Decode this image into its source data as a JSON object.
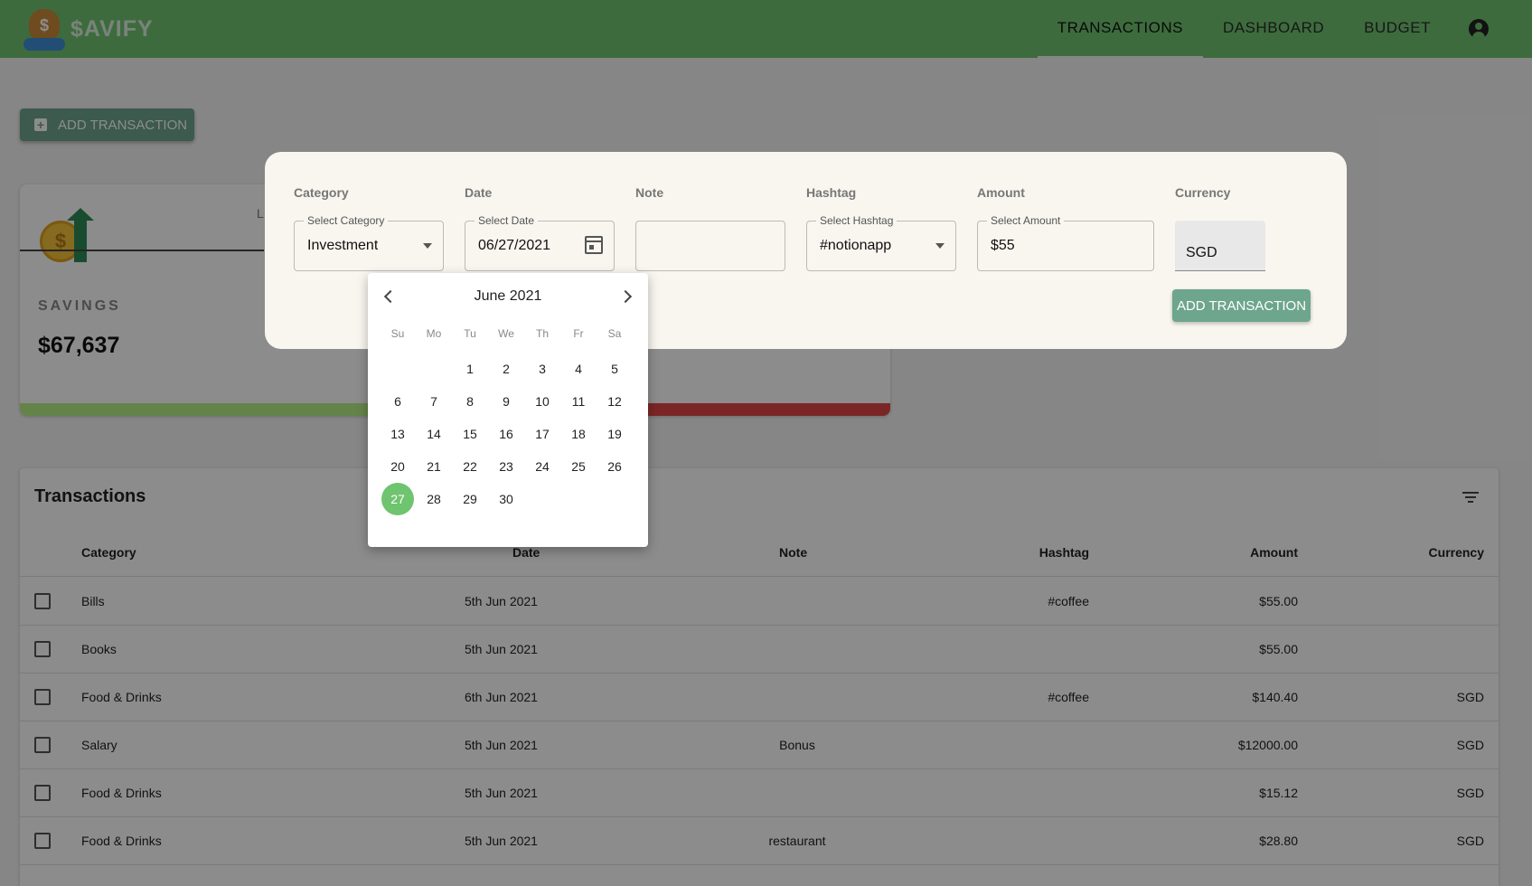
{
  "app": {
    "name": "$AVIFY"
  },
  "nav": {
    "tabs": [
      "TRANSACTIONS",
      "DASHBOARD",
      "BUDGET"
    ],
    "active": "TRANSACTIONS"
  },
  "page": {
    "add_transaction_label": "ADD TRANSACTION"
  },
  "savings": {
    "partial_label": "L",
    "label": "SAVINGS",
    "value": "$67,637"
  },
  "transactions": {
    "title": "Transactions",
    "columns": [
      "Category",
      "Date",
      "Note",
      "Hashtag",
      "Amount",
      "Currency"
    ],
    "rows": [
      {
        "category": "Bills",
        "date": "5th Jun 2021",
        "note": "",
        "hashtag": "#coffee",
        "amount": "$55.00",
        "currency": ""
      },
      {
        "category": "Books",
        "date": "5th Jun 2021",
        "note": "",
        "hashtag": "",
        "amount": "$55.00",
        "currency": ""
      },
      {
        "category": "Food & Drinks",
        "date": "6th Jun 2021",
        "note": "",
        "hashtag": "#coffee",
        "amount": "$140.40",
        "currency": "SGD"
      },
      {
        "category": "Salary",
        "date": "5th Jun 2021",
        "note": "Bonus",
        "hashtag": "",
        "amount": "$12000.00",
        "currency": "SGD"
      },
      {
        "category": "Food & Drinks",
        "date": "5th Jun 2021",
        "note": "",
        "hashtag": "",
        "amount": "$15.12",
        "currency": "SGD"
      },
      {
        "category": "Food & Drinks",
        "date": "5th Jun 2021",
        "note": "restaurant",
        "hashtag": "",
        "amount": "$28.80",
        "currency": "SGD"
      }
    ]
  },
  "form": {
    "category": {
      "label": "Category",
      "legend": "Select Category",
      "value": "Investment"
    },
    "date": {
      "label": "Date",
      "legend": "Select Date",
      "value": "06/27/2021"
    },
    "note": {
      "label": "Note",
      "value": ""
    },
    "hashtag": {
      "label": "Hashtag",
      "legend": "Select Hashtag",
      "value": "#notionapp"
    },
    "amount": {
      "label": "Amount",
      "legend": "Select Amount",
      "value": "$55"
    },
    "currency": {
      "label": "Currency",
      "value": "SGD"
    },
    "submit_label": "ADD TRANSACTION"
  },
  "calendar": {
    "month": "June 2021",
    "weekdays": [
      "Su",
      "Mo",
      "Tu",
      "We",
      "Th",
      "Fr",
      "Sa"
    ],
    "first_weekday": 2,
    "days": 30,
    "selected": 27
  },
  "colors": {
    "appbar": "#6fc46f",
    "accent": "#6ea58d",
    "selected_day": "#6fc46f",
    "savings_green": "#b7ee86",
    "savings_red": "#e04545"
  }
}
